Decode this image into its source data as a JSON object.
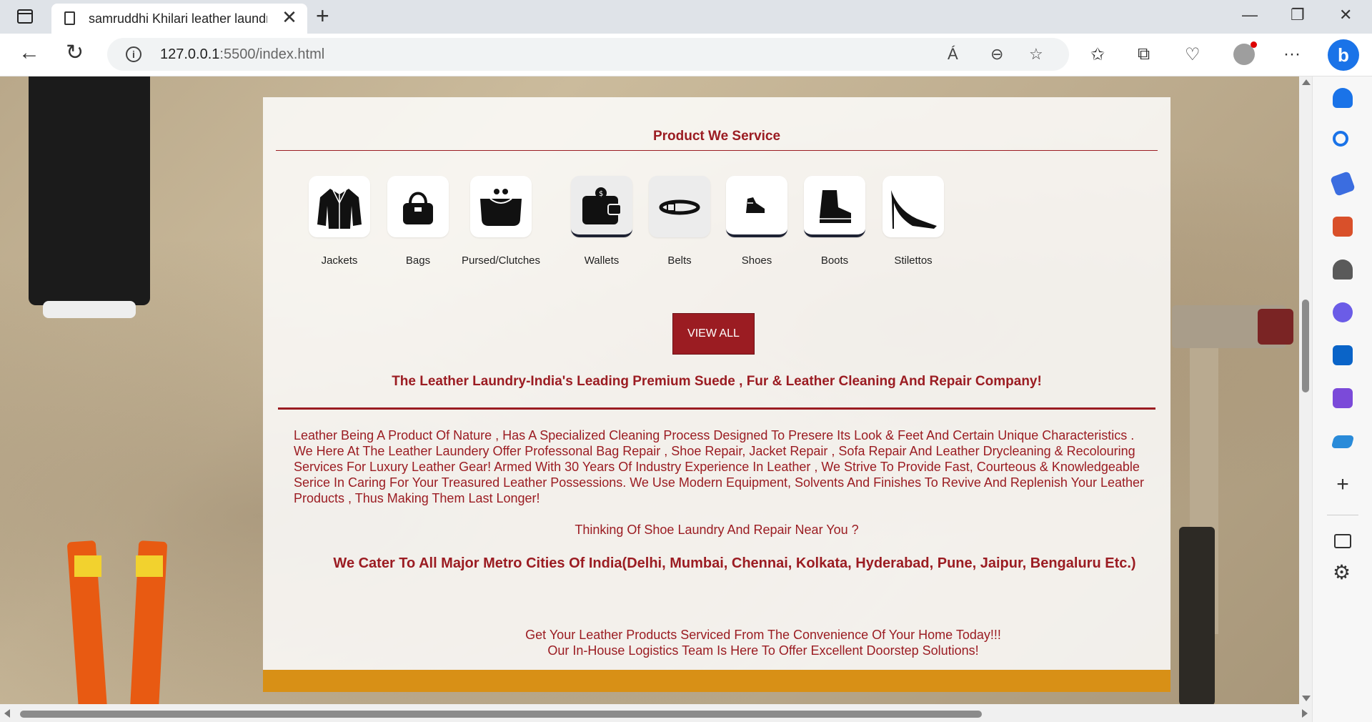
{
  "browser": {
    "tab_title": "samruddhi Khilari leather laundry",
    "tab_close": "✕",
    "new_tab": "+",
    "url_host": "127.0.0.1",
    "url_rest": ":5500/index.html",
    "window_minimize": "—",
    "window_restore": "❐",
    "window_close": "✕",
    "read_aloud": "Á",
    "zoom_out": "⊖",
    "favorite": "☆",
    "favorites": "✩",
    "collections": "⧉",
    "performance": "♡",
    "more": "···",
    "bing": "b"
  },
  "page": {
    "section_title": "Product We Service",
    "products": [
      {
        "label": "Jackets",
        "icon": "jacket-icon"
      },
      {
        "label": "Bags",
        "icon": "bag-icon"
      },
      {
        "label": "Pursed/Clutches",
        "icon": "purse-icon"
      },
      {
        "label": "Wallets",
        "icon": "wallet-icon"
      },
      {
        "label": "Belts",
        "icon": "belt-icon"
      },
      {
        "label": "Shoes",
        "icon": "shoe-icon"
      },
      {
        "label": "Boots",
        "icon": "boot-icon"
      },
      {
        "label": "Stilettos",
        "icon": "stiletto-icon"
      }
    ],
    "view_all": "VIEW ALL",
    "headline": "The Leather Laundry-India's Leading Premium Suede , Fur & Leather Cleaning And Repair Company!",
    "paragraph": "Leather Being A Product Of Nature , Has A Specialized Cleaning Process Designed To Presere Its Look & Feet And Certain Unique Characteristics . We Here At The Leather Laundery Offer Professonal Bag Repair , Shoe Repair, Jacket Repair , Sofa Repair And Leather Drycleaning & Recolouring Services For Luxury Leather Gear! Armed With 30 Years Of Industry Experience In Leather , We Strive To Provide Fast, Courteous & Knowledgeable Serice In Caring For Your Treasured Leather Possessions. We Use Modern Equipment, Solvents And Finishes To Revive And Replenish Your Leather Products , Thus Making Them Last Longer!",
    "question": "Thinking Of Shoe Laundry And Repair Near You ?",
    "cities": "We Cater To All Major Metro Cities Of India(Delhi, Mumbai, Chennai, Kolkata, Hyderabad, Pune, Jaipur, Bengaluru Etc.)",
    "closing_line1": "Get Your Leather Products Serviced From The Convenience Of Your Home Today!!!",
    "closing_line2": "Our In-House Logistics Team Is Here To Offer Excellent Doorstep Solutions!"
  },
  "colors": {
    "brand_red": "#9b1c22",
    "footer_orange": "#d89016"
  }
}
